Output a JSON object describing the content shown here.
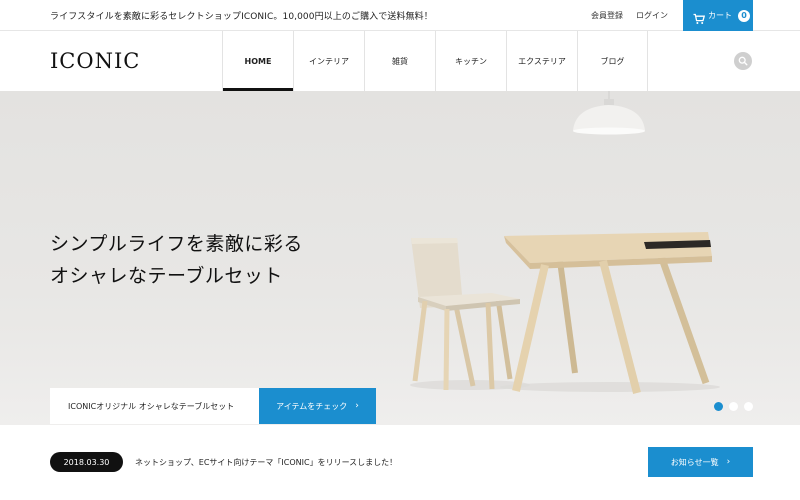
{
  "topbar": {
    "announcement": "ライフスタイルを素敵に彩るセレクトショップICONIC。10,000円以上のご購入で送料無料！",
    "links": [
      "会員登録",
      "ログイン"
    ],
    "cart": {
      "label": "カート",
      "count": "0",
      "icon": "cart-icon",
      "color": "#1b8ecf"
    }
  },
  "header": {
    "logo": "ICONIC",
    "nav": [
      {
        "label": "HOME",
        "active": true
      },
      {
        "label": "インテリア",
        "active": false
      },
      {
        "label": "雑貨",
        "active": false
      },
      {
        "label": "キッチン",
        "active": false
      },
      {
        "label": "エクステリア",
        "active": false
      },
      {
        "label": "ブログ",
        "active": false
      }
    ],
    "search_icon": "search-icon"
  },
  "hero": {
    "headline_line1": "シンプルライフを素敵に彩る",
    "headline_line2": "オシャレなテーブルセット",
    "caption": "ICONICオリジナル オシャレなテーブルセット",
    "cta_label": "アイテムをチェック",
    "cta_icon": "chevron-right-icon",
    "slides": 3,
    "active_slide": 1
  },
  "news": {
    "date": "2018.03.30",
    "text": "ネットショップ、ECサイト向けテーマ「ICONIC」をリリースしました！",
    "button_label": "お知らせ一覧",
    "button_icon": "chevron-right-icon"
  },
  "colors": {
    "accent": "#1b8ecf",
    "dark": "#111111"
  }
}
